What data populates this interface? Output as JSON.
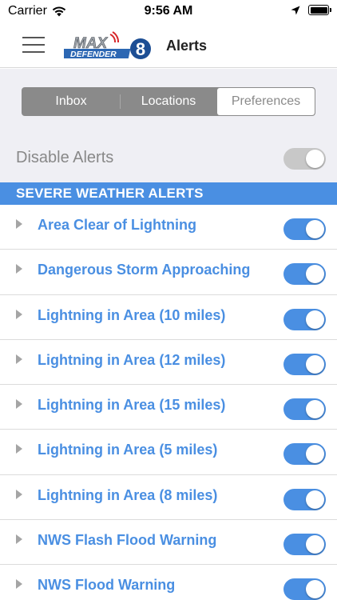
{
  "status_bar": {
    "carrier": "Carrier",
    "time": "9:56 AM"
  },
  "nav": {
    "title": "Alerts",
    "logo": {
      "line1": "MAX",
      "line2": "DEFENDER",
      "number": "8"
    }
  },
  "segments": [
    {
      "label": "Inbox",
      "active": false
    },
    {
      "label": "Locations",
      "active": false
    },
    {
      "label": "Preferences",
      "active": true
    }
  ],
  "disable_alerts": {
    "label": "Disable Alerts",
    "enabled": false
  },
  "section": {
    "title": "SEVERE WEATHER ALERTS"
  },
  "alerts": [
    {
      "label": "Area Clear of Lightning",
      "enabled": true
    },
    {
      "label": "Dangerous Storm Approaching",
      "enabled": true
    },
    {
      "label": "Lightning in Area (10 miles)",
      "enabled": true
    },
    {
      "label": "Lightning in Area (12 miles)",
      "enabled": true
    },
    {
      "label": "Lightning in Area (15 miles)",
      "enabled": true
    },
    {
      "label": "Lightning in Area (5 miles)",
      "enabled": true
    },
    {
      "label": "Lightning in Area (8 miles)",
      "enabled": true
    },
    {
      "label": "NWS Flash Flood Warning",
      "enabled": true
    },
    {
      "label": "NWS Flood Warning",
      "enabled": true
    }
  ],
  "colors": {
    "accent": "#4a8fe2",
    "segment_bg": "#8a8a8a",
    "background": "#efeff4",
    "muted_text": "#888888"
  }
}
